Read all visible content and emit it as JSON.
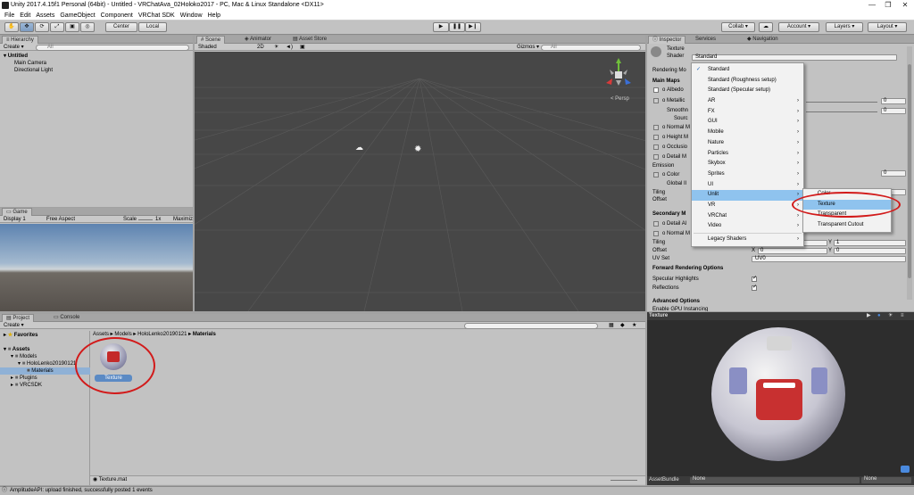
{
  "window": {
    "title": "Unity 2017.4.15f1 Personal (64bit) - Untitled - VRChatAva_02Holoko2017 - PC, Mac & Linux Standalone <DX11>",
    "min": "—",
    "max": "❐",
    "close": "✕"
  },
  "menu": [
    "File",
    "Edit",
    "Assets",
    "GameObject",
    "Component",
    "VRChat SDK",
    "Window",
    "Help"
  ],
  "toolbar": {
    "center": "Center",
    "local": "Local",
    "collab": "Collab ▾",
    "account": "Account ▾",
    "layers": "Layers ▾",
    "layout": "Layout ▾"
  },
  "hierarchy": {
    "tab": "Hierarchy",
    "create": "Create ▾",
    "search": "All",
    "scene": "Untitled",
    "items": [
      "Main Camera",
      "Directional Light"
    ]
  },
  "scene": {
    "tabs": [
      "Scene",
      "Animator",
      "Asset Store"
    ],
    "shaded": "Shaded",
    "twod": "2D",
    "gizmos": "Gizmos ▾",
    "search": "All",
    "persp": "< Persp"
  },
  "game": {
    "tab": "Game",
    "display": "Display 1",
    "aspect": "Free Aspect",
    "scale": "Scale",
    "scale_val": "1x",
    "maximize": "Maximiz"
  },
  "project": {
    "tabs": [
      "Project",
      "Console"
    ],
    "create": "Create ▾",
    "tree": {
      "favorites": "Favorites",
      "assets": "Assets",
      "models": "Models",
      "holo": "HoloLenko20190121",
      "materials": "Materials",
      "plugins": "Plugins",
      "vrcsdk": "VRCSDK"
    },
    "breadcrumb": [
      "Assets",
      "Models",
      "HoloLenko20190121",
      "Materials"
    ],
    "asset": "Texture",
    "footer": "Texture.mat"
  },
  "inspector": {
    "tabs": [
      "Inspector",
      "Services",
      "Navigation"
    ],
    "name": "Texture",
    "shader_label": "Shader",
    "shader_value": "Standard",
    "rendering": "Rendering Mo",
    "main_maps": "Main Maps",
    "albedo": "Albedo",
    "metallic": "Metallic",
    "smooth": "Smoothn",
    "source": "Sourc",
    "normal": "Normal M",
    "height": "Height M",
    "occlusion": "Occlusio",
    "detail": "Detail M",
    "emission": "Emission",
    "color": "Color",
    "global": "Global Il",
    "tiling": "Tiling",
    "offset": "Offset",
    "secondary": "Secondary M",
    "detail_al": "Detail Al",
    "normal2": "Normal M",
    "tiling2": "Tiling",
    "offset2": "Offset",
    "uvset": "UV Set",
    "uv0": "UV0",
    "x": "X",
    "y": "Y",
    "zero": "0",
    "one": "1",
    "forward": "Forward Rendering Options",
    "specular": "Specular Highlights",
    "reflections": "Reflections",
    "advanced": "Advanced Options",
    "gpu": "Enable GPU Instancing",
    "preview_title": "Texture",
    "assetbundle": "AssetBundle",
    "none": "None"
  },
  "shader_menu": [
    "Standard",
    "Standard (Roughness setup)",
    "Standard (Specular setup)",
    "AR",
    "FX",
    "GUI",
    "Mobile",
    "Nature",
    "Particles",
    "Skybox",
    "Sprites",
    "UI",
    "Unlit",
    "VR",
    "VRChat",
    "Video",
    "Legacy Shaders"
  ],
  "unlit_menu": [
    "Color",
    "Texture",
    "Transparent",
    "Transparent Cutout"
  ],
  "status": "AmplitudeAPI: upload finished, successfully posted 1 events"
}
